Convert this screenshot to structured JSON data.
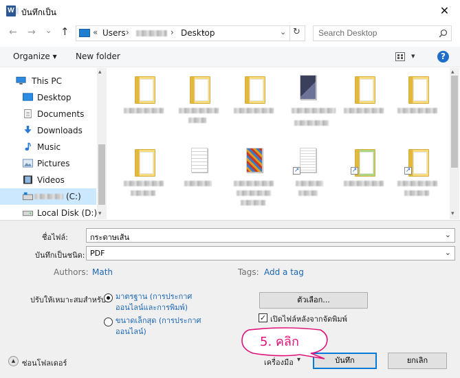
{
  "window": {
    "title": "บันทึกเป็น",
    "app_icon_letter": "W",
    "close_glyph": "✕"
  },
  "address_bar": {
    "back_glyph": "←",
    "forward_glyph": "→",
    "recent_glyph": "⌄",
    "up_glyph": "↑",
    "overflow": "«",
    "crumbs": [
      "Users",
      "Desktop"
    ],
    "separator": "›",
    "dropdown_glyph": "⌄",
    "refresh_glyph": "↻"
  },
  "search": {
    "placeholder": "Search Desktop",
    "icon": "magnifier-icon"
  },
  "toolbar": {
    "organize_label": "Organize ▾",
    "new_folder_label": "New folder",
    "view_glyph": "▾",
    "help_glyph": "?"
  },
  "nav_pane": {
    "items": [
      {
        "label": "This PC",
        "icon": "pc-icon"
      },
      {
        "label": "Desktop",
        "icon": "desktop-icon"
      },
      {
        "label": "Documents",
        "icon": "documents-icon"
      },
      {
        "label": "Downloads",
        "icon": "downloads-icon"
      },
      {
        "label": "Music",
        "icon": "music-icon"
      },
      {
        "label": "Pictures",
        "icon": "pictures-icon"
      },
      {
        "label": "Videos",
        "icon": "videos-icon"
      },
      {
        "label": "(C:)",
        "icon": "drive-icon"
      },
      {
        "label": "Local Disk (D:)",
        "icon": "disk-icon"
      }
    ],
    "scroll_up": "▴",
    "scroll_down": "▾"
  },
  "form": {
    "filename_label": "ชื่อไฟล์:",
    "filename_value": "กระดาษเส้น",
    "filetype_label": "บันทึกเป็นชนิด:",
    "filetype_value": "PDF",
    "authors_label": "Authors:",
    "authors_value": "Math",
    "tags_label": "Tags:",
    "tags_value": "Add a tag",
    "optimize_label": "ปรับให้เหมาะสมสำหรับ:",
    "option_standard": "มาตรฐาน (การประกาศ ออนไลน์และการพิมพ์)",
    "option_minimum": "ขนาดเล็กสุด (การประกาศ ออนไลน์)",
    "options_button": "ตัวเลือก...",
    "open_after_label": "เปิดไฟล์หลังจากจัดพิมพ์",
    "checkmark": "✓",
    "hide_folders_label": "ซ่อนโฟลเดอร์",
    "hide_folders_glyph": "▲",
    "tools_label": "เครื่องมือ",
    "tools_glyph": "▾",
    "save_label": "บันทึก",
    "cancel_label": "ยกเลิก"
  },
  "annotation": {
    "text": "5. คลิก",
    "color": "#e0107a"
  }
}
